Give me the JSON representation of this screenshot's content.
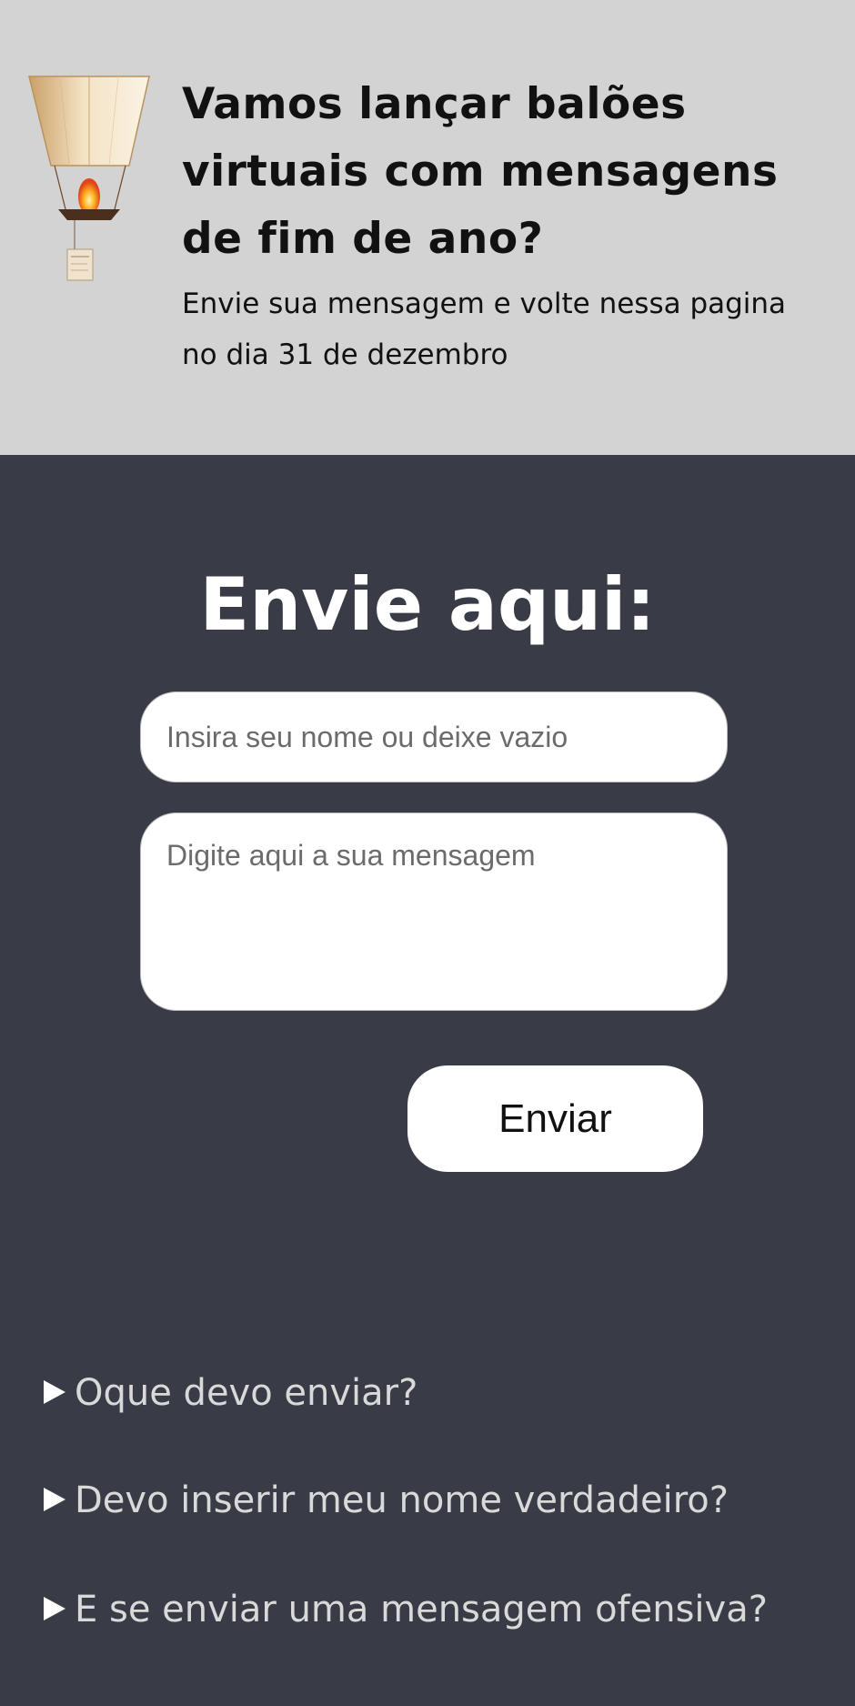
{
  "hero": {
    "title": "Vamos lançar balões virtuais com mensagens de fim de ano?",
    "subtitle": "Envie sua mensagem e volte nessa pagina no dia 31 de dezembro",
    "icon": "paper-lantern-icon"
  },
  "form": {
    "heading": "Envie aqui:",
    "name_placeholder": "Insira seu nome ou deixe vazio",
    "message_placeholder": "Digite aqui a sua mensagem",
    "submit_label": "Enviar"
  },
  "faq": [
    {
      "question": "Oque devo enviar?"
    },
    {
      "question": "Devo inserir meu nome verdadeiro?"
    },
    {
      "question": "E se enviar uma mensagem ofensiva?"
    }
  ],
  "colors": {
    "hero_bg": "#d3d3d3",
    "page_bg": "#393c46",
    "heading_text": "#ffffff",
    "faq_text": "#d9d9d9"
  }
}
